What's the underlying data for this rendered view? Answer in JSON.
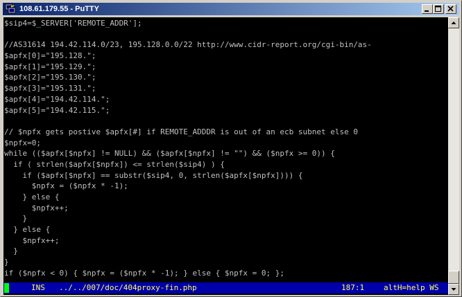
{
  "window": {
    "title": "108.61.179.55 - PuTTY"
  },
  "icons": {
    "app": "putty-computer-icon",
    "minimize": "minimize-icon",
    "maximize": "maximize-icon",
    "close": "close-icon",
    "scroll_up": "arrow-up-icon",
    "scroll_down": "arrow-down-icon"
  },
  "colors": {
    "titlebar_start": "#0a246a",
    "titlebar_end": "#a6caf0",
    "terminal_bg": "#000000",
    "terminal_fg": "#c0c0c0",
    "statusbar_bg": "#0000aa",
    "statusbar_fg": "#ffff55",
    "cursor": "#00ff00"
  },
  "terminal": {
    "lines": [
      "$sip4=$_SERVER['REMOTE_ADDR'];",
      "",
      "//AS31614 194.42.114.0/23, 195.128.0.0/22 http://www.cidr-report.org/cgi-bin/as-",
      "$apfx[0]=\"195.128.\";",
      "$apfx[1]=\"195.129.\";",
      "$apfx[2]=\"195.130.\";",
      "$apfx[3]=\"195.131.\";",
      "$apfx[4]=\"194.42.114.\";",
      "$apfx[5]=\"194.42.115.\";",
      "",
      "// $npfx gets postive $apfx[#] if REMOTE_ADDDR is out of an ecb subnet else 0",
      "$npfx=0;",
      "while (($apfx[$npfx] != NULL) && ($apfx[$npfx] != \"\") && ($npfx >= 0)) {",
      "  if ( strlen($apfx[$npfx]) <= strlen($sip4) ) {",
      "    if ($apfx[$npfx] == substr($sip4, 0, strlen($apfx[$npfx]))) {",
      "      $npfx = ($npfx * -1);",
      "    } else {",
      "      $npfx++;",
      "    }",
      "  } else {",
      "    $npfx++;",
      "  }",
      "}",
      "if ($npfx < 0) { $npfx = ($npfx * -1); } else { $npfx = 0; };"
    ]
  },
  "statusbar": {
    "mode": "INS",
    "path": "../../007/doc/404proxy-fin.php",
    "position": "187:1",
    "help": "altH=help WS"
  }
}
